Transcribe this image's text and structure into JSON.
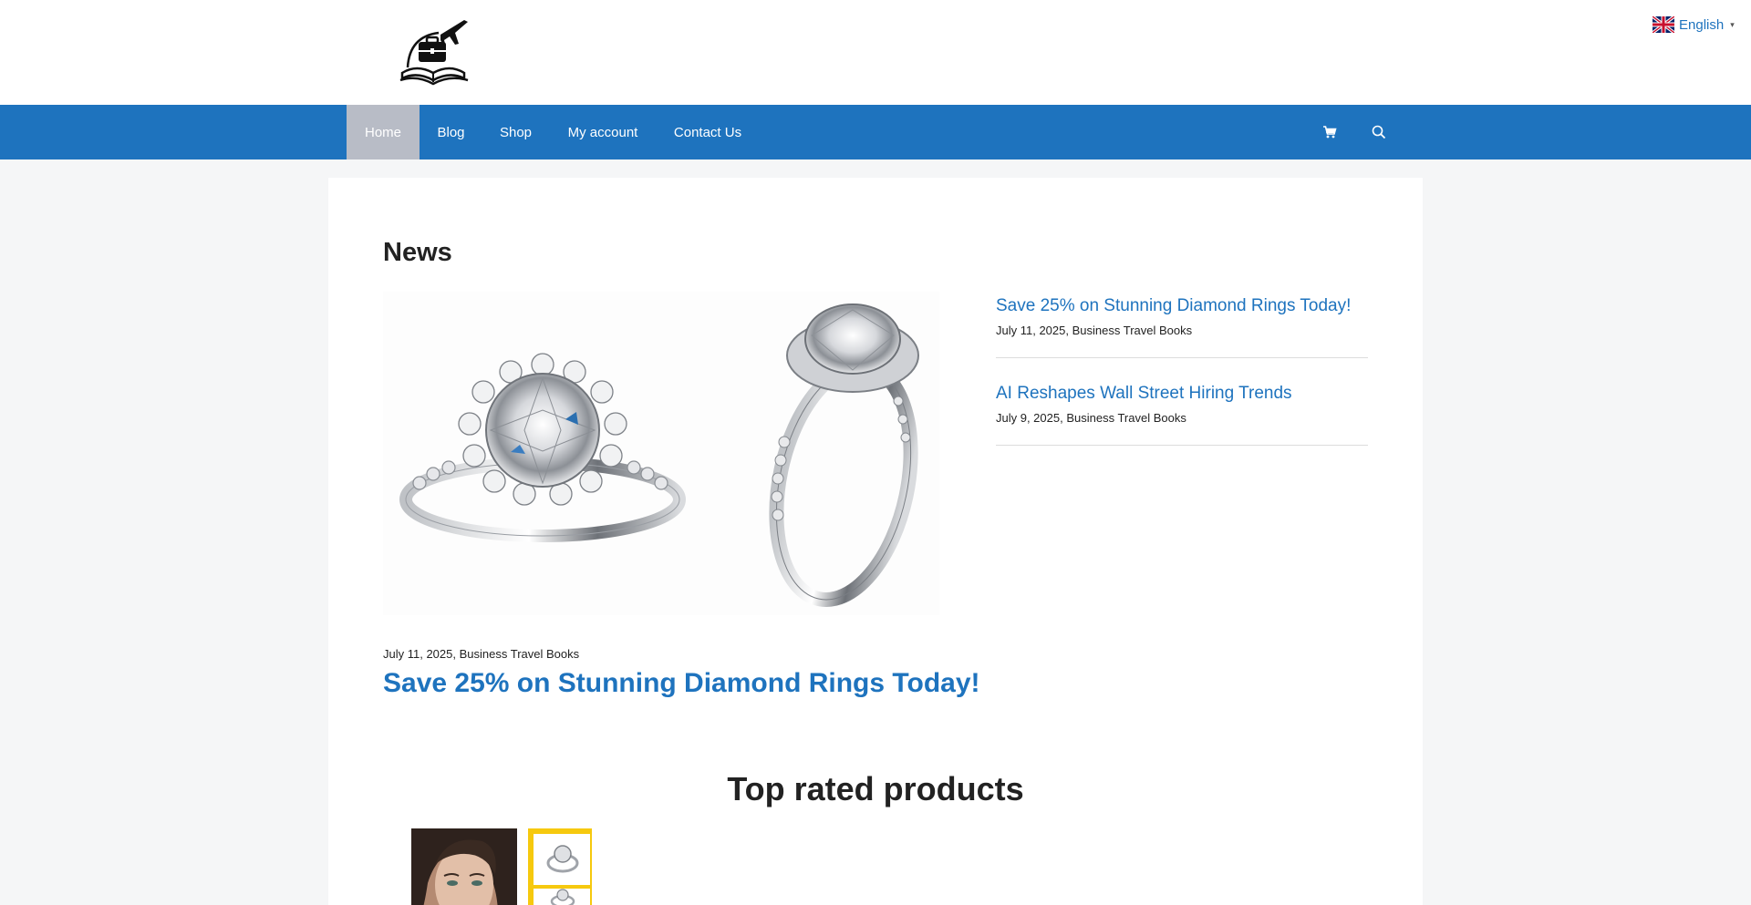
{
  "header": {
    "logo_icon": "suitcase-plane-book-logo",
    "language": {
      "label": "English",
      "flag_icon": "uk-flag-icon",
      "caret_icon": "caret-down-icon"
    }
  },
  "nav": {
    "items": [
      {
        "label": "Home",
        "active": true
      },
      {
        "label": "Blog"
      },
      {
        "label": "Shop"
      },
      {
        "label": "My account"
      },
      {
        "label": "Contact Us"
      }
    ],
    "cart_icon": "cart-icon",
    "search_icon": "search-icon"
  },
  "colors": {
    "accent": "#1e73be",
    "nav_active": "#b8bcc6",
    "page_bg": "#f5f6f7"
  },
  "news": {
    "title": "News",
    "featured": {
      "meta_date": "July 11, 2025",
      "meta_category": "Business Travel Books",
      "title": "Save 25% on Stunning Diamond Rings Today!",
      "image_icon": "diamond-rings-image"
    },
    "side_posts": [
      {
        "title": "Save 25% on Stunning Diamond Rings Today!",
        "date": "July 11, 2025",
        "category": "Business Travel Books"
      },
      {
        "title": "AI Reshapes Wall Street Hiring Trends",
        "date": "July 9, 2025",
        "category": "Business Travel Books"
      }
    ]
  },
  "products": {
    "title": "Top rated products"
  }
}
